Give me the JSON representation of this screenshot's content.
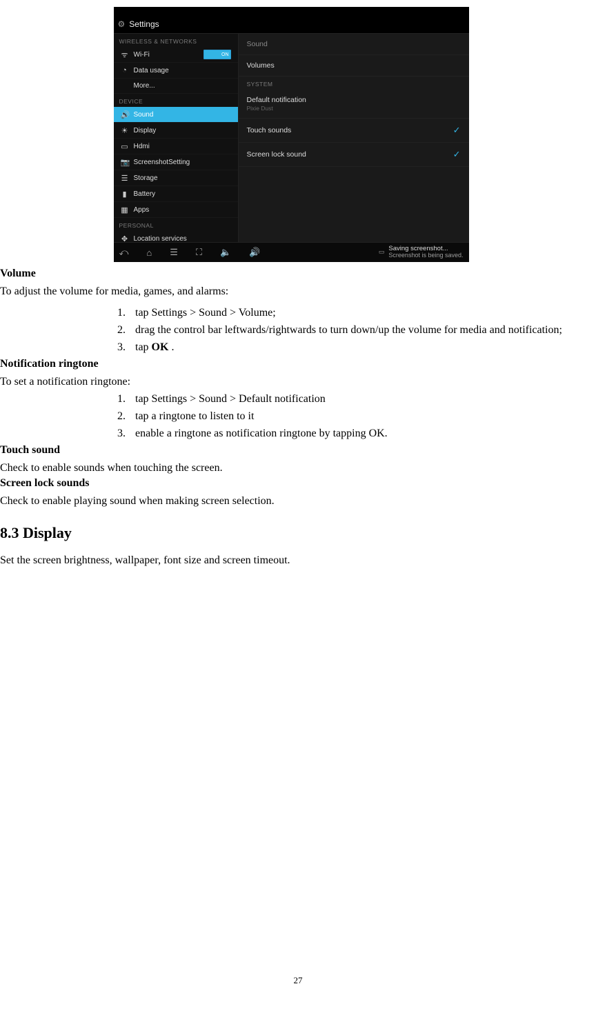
{
  "screenshot": {
    "titlebar": {
      "icon": "⚙",
      "title": "Settings"
    },
    "left": {
      "hdr_wireless": "WIRELESS & NETWORKS",
      "wifi": {
        "icon": "ᯤ",
        "label": "Wi-Fi",
        "toggle": "ON"
      },
      "data": {
        "icon": "◔",
        "label": "Data usage"
      },
      "more": {
        "icon": "",
        "label": "More..."
      },
      "hdr_device": "DEVICE",
      "sound": {
        "icon": "🔊",
        "label": "Sound"
      },
      "display": {
        "icon": "☀",
        "label": "Display"
      },
      "hdmi": {
        "icon": "▭",
        "label": "Hdmi"
      },
      "sshot": {
        "icon": "📷",
        "label": "ScreenshotSetting"
      },
      "storage": {
        "icon": "☰",
        "label": "Storage"
      },
      "battery": {
        "icon": "▮",
        "label": "Battery"
      },
      "apps": {
        "icon": "▦",
        "label": "Apps"
      },
      "hdr_personal": "PERSONAL",
      "location": {
        "icon": "✥",
        "label": "Location services"
      }
    },
    "right": {
      "tab": "Sound",
      "volumes": "Volumes",
      "hdr_system": "SYSTEM",
      "notif_title": "Default notification",
      "notif_sub": "Pixie Dust",
      "touch_sounds": "Touch sounds",
      "lock_sound": "Screen lock sound",
      "chk": "✓"
    },
    "navbar": {
      "back": "⤺",
      "home": "⌂",
      "recent": "☰",
      "sshot": "⛶",
      "voldn": "🔈",
      "volup": "🔊",
      "pic": "▭",
      "toast_title": "Saving screenshot...",
      "toast_sub": "Screenshot is being saved."
    }
  },
  "doc": {
    "h_volume": "Volume",
    "p_volume": "To adjust the volume for media, games, and alarms:",
    "vol_1_num": "1.",
    "vol_1": "tap Settings > Sound > Volume;",
    "vol_2_num": "2.",
    "vol_2": "drag the control bar leftwards/rightwards to turn down/up the volume for media and notification;",
    "vol_3_num": "3.",
    "vol_3a": "tap ",
    "vol_3b": "OK",
    "vol_3c": " .",
    "h_notif": "Notification ringtone",
    "p_notif": "To set a notification ringtone:",
    "not_1_num": "1.",
    "not_1": "tap Settings > Sound > Default notification",
    "not_2_num": "2.",
    "not_2": "tap a ringtone to listen to it",
    "not_3_num": "3.",
    "not_3": "enable a ringtone as notification ringtone by tapping OK.",
    "h_touch": "Touch sound",
    "p_touch": "Check to enable sounds when touching the screen.",
    "h_lock": "Screen lock sounds",
    "p_lock": "Check to enable playing sound when making screen selection.",
    "h_display": "8.3 Display",
    "p_display": "Set the screen brightness, wallpaper, font size and screen timeout.",
    "page_number": "27"
  }
}
